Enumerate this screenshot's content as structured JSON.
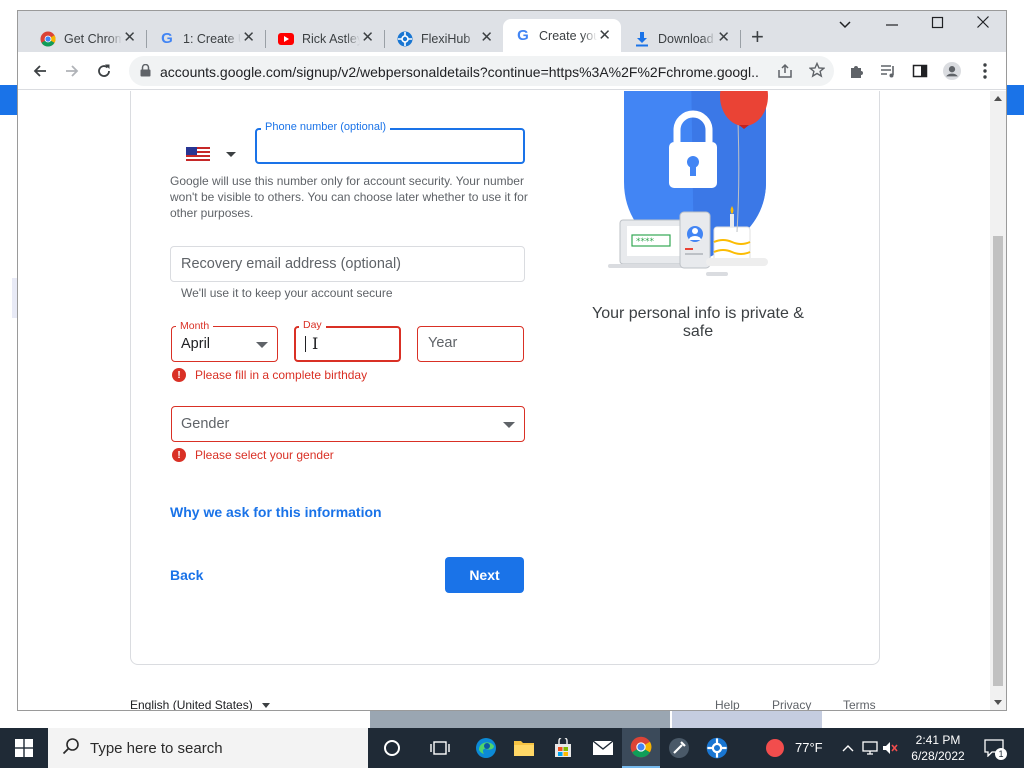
{
  "browser": {
    "tabs": [
      {
        "title": "Get Chrome",
        "icon": "chrome-icon"
      },
      {
        "title": "1: Create U",
        "icon": "google-icon"
      },
      {
        "title": "Rick Astley",
        "icon": "youtube-icon"
      },
      {
        "title": "FlexiHub",
        "icon": "flexihub-icon"
      },
      {
        "title": "Create your",
        "icon": "google-icon"
      },
      {
        "title": "Download",
        "icon": "download-icon"
      }
    ],
    "active_tab_index": 4,
    "url": "accounts.google.com/signup/v2/webpersonaldetails?continue=https%3A%2F%2Fchrome.googl..."
  },
  "form": {
    "phone_label": "Phone number (optional)",
    "phone_value": "",
    "phone_help": "Google will use this number only for account security. Your number won't be visible to others. You can choose later whether to use it for other purposes.",
    "recovery_placeholder": "Recovery email address (optional)",
    "recovery_help": "We'll use it to keep your account secure",
    "month_label": "Month",
    "month_value": "April",
    "day_label": "Day",
    "day_value": "",
    "year_placeholder": "Year",
    "birthday_error": "Please fill in a complete birthday",
    "gender_placeholder": "Gender",
    "gender_error": "Please select your gender",
    "why_link": "Why we ask for this information",
    "back_button": "Back",
    "next_button": "Next"
  },
  "illustration_caption": "Your personal info is private & safe",
  "footer": {
    "language": "English (United States)",
    "help": "Help",
    "privacy": "Privacy",
    "terms": "Terms"
  },
  "taskbar": {
    "search_placeholder": "Type here to search",
    "temperature": "77°F",
    "time": "2:41 PM",
    "date": "6/28/2022",
    "notification_count": "1"
  },
  "colors": {
    "accent": "#1a73e8",
    "error": "#d93025",
    "taskbar": "#1f2a36"
  }
}
